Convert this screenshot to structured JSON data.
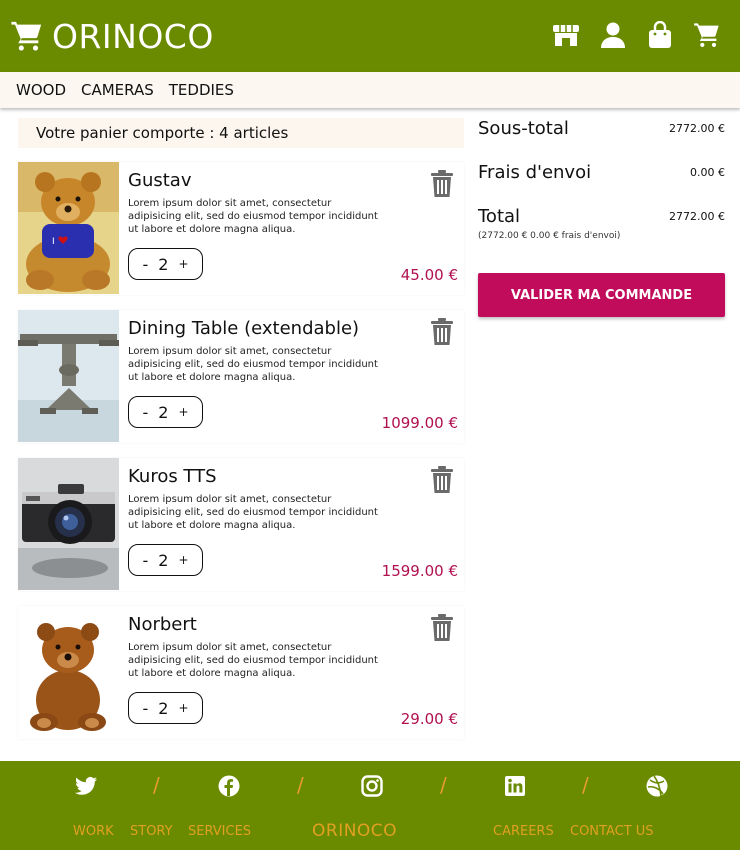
{
  "header": {
    "title": "ORINOCO",
    "icons": [
      "store-icon",
      "user-icon",
      "shopping-bag-icon",
      "cart-icon"
    ]
  },
  "nav": {
    "items": [
      {
        "label": "WOOD"
      },
      {
        "label": "CAMERAS"
      },
      {
        "label": "TEDDIES"
      }
    ]
  },
  "cart": {
    "summary_text": "Votre panier comporte : 4 articles",
    "items": [
      {
        "name": "Gustav",
        "description": "Lorem ipsum dolor sit amet, consectetur adipisicing elit, sed do eiusmod tempor incididunt ut labore et dolore magna aliqua.",
        "qty_minus": "-",
        "quantity": "2",
        "qty_plus": "+",
        "price": "45.00 €"
      },
      {
        "name": "Dining Table (extendable)",
        "description": "Lorem ipsum dolor sit amet, consectetur adipisicing elit, sed do eiusmod tempor incididunt ut labore et dolore magna aliqua.",
        "qty_minus": "-",
        "quantity": "2",
        "qty_plus": "+",
        "price": "1099.00 €"
      },
      {
        "name": "Kuros TTS",
        "description": "Lorem ipsum dolor sit amet, consectetur adipisicing elit, sed do eiusmod tempor incididunt ut labore et dolore magna aliqua.",
        "qty_minus": "-",
        "quantity": "2",
        "qty_plus": "+",
        "price": "1599.00 €"
      },
      {
        "name": "Norbert",
        "description": "Lorem ipsum dolor sit amet, consectetur adipisicing elit, sed do eiusmod tempor incididunt ut labore et dolore magna aliqua.",
        "qty_minus": "-",
        "quantity": "2",
        "qty_plus": "+",
        "price": "29.00 €"
      }
    ]
  },
  "summary": {
    "subtotal_label": "Sous-total",
    "subtotal_value": "2772.00 €",
    "shipping_label": "Frais d'envoi",
    "shipping_value": "0.00 €",
    "total_label": "Total",
    "total_value": "2772.00 €",
    "total_detail": "(2772.00 € 0.00 € frais d'envoi)",
    "validate_label": "VALIDER MA COMMANDE"
  },
  "footer": {
    "social": [
      "twitter-icon",
      "facebook-icon",
      "instagram-icon",
      "linkedin-icon",
      "dribbble-icon"
    ],
    "separator": "/",
    "links_left": [
      {
        "label": "WORK"
      },
      {
        "label": "STORY"
      },
      {
        "label": "SERVICES"
      }
    ],
    "brand": "ORINOCO",
    "links_right": [
      {
        "label": "CAREERS"
      },
      {
        "label": "CONTACT US"
      }
    ]
  },
  "colors": {
    "primary_green": "#6a8a00",
    "accent_magenta": "#c10b5b",
    "price_color": "#b0104f",
    "footer_text": "#e0a020"
  }
}
